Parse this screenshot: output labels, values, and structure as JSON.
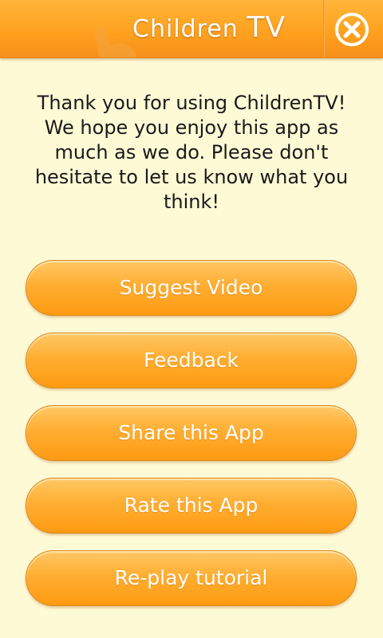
{
  "header": {
    "title_prefix": "Children",
    "title_suffix": "TV",
    "close_icon": "close-icon"
  },
  "message": "Thank you for using ChildrenTV! We hope you enjoy this app as much as we do. Please don't hesitate to let us know what you think!",
  "menu": {
    "items": [
      {
        "label": "Suggest Video"
      },
      {
        "label": "Feedback"
      },
      {
        "label": "Share this App"
      },
      {
        "label": "Rate this App"
      },
      {
        "label": "Re-play tutorial"
      }
    ]
  },
  "colors": {
    "background": "#fffad6",
    "accent": "#ffa21f",
    "button_text": "#ffffff",
    "text": "#1a1a1a"
  }
}
